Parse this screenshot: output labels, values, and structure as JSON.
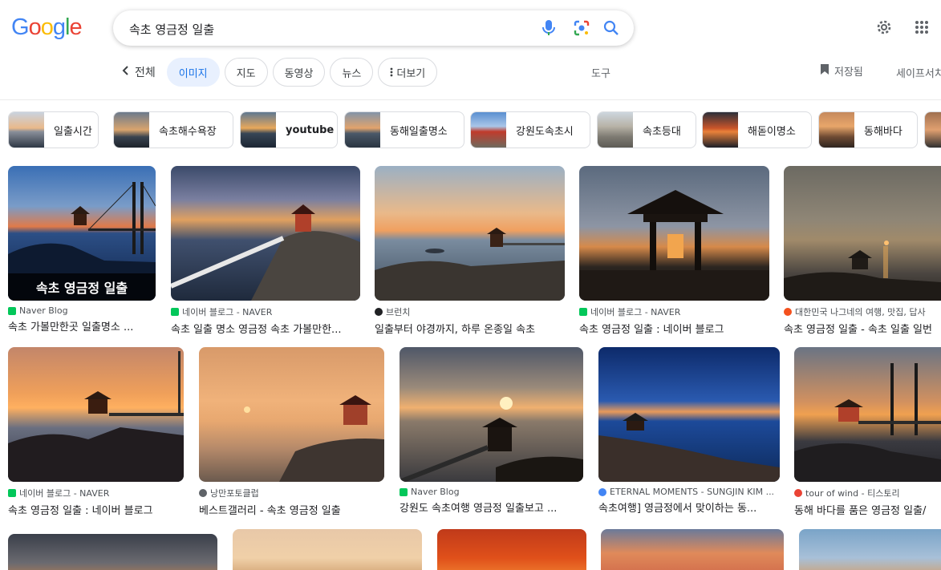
{
  "logo": "Google",
  "search": {
    "query": "속초 영금정 일출"
  },
  "tabs": {
    "back_label": "전체",
    "items": [
      "이미지",
      "지도",
      "동영상",
      "뉴스",
      "더보기"
    ],
    "active_index": 0,
    "tools": "도구",
    "saved": "저장됨",
    "safesearch": "세이프서치"
  },
  "suggestions": [
    "일출시간",
    "속초해수욕장",
    "youtube",
    "동해일출명소",
    "강원도속초시",
    "속초등대",
    "해돋이명소",
    "동해바다"
  ],
  "results": [
    {
      "source": "Naver Blog",
      "title": "속초 가볼만한곳 일출명소 ...",
      "overlay": "속초 영금정 일출",
      "fav_color": "#03c75a"
    },
    {
      "source": "네이버 블로그 - NAVER",
      "title": "속초 일출 명소 영금정 속초 가볼만한...",
      "fav_color": "#03c75a"
    },
    {
      "source": "브런치",
      "title": "일출부터 야경까지, 하루 온종일 속초",
      "fav_color": "#202124"
    },
    {
      "source": "네이버 블로그 - NAVER",
      "title": "속초 영금정 일출 : 네이버 블로그",
      "fav_color": "#03c75a"
    },
    {
      "source": "대한민국 나그네의 여행, 맛집, 답사",
      "title": "속초 영금정 일출 - 속초 일출 일번",
      "fav_color": "#f4511e"
    },
    {
      "source": "네이버 블로그 - NAVER",
      "title": "속초 영금정 일출 : 네이버 블로그",
      "fav_color": "#03c75a"
    },
    {
      "source": "낭만포토클럽",
      "title": "베스트갤러리 - 속초 영금정 일출",
      "fav_color": "#5f6368"
    },
    {
      "source": "Naver Blog",
      "title": "강원도 속초여행 영금정 일출보고 ...",
      "fav_color": "#03c75a"
    },
    {
      "source": "ETERNAL MOMENTS - SUNGJIN KIM ...",
      "title": "속초여행] 영금정에서 맞이하는 동...",
      "fav_color": "#4285f4"
    },
    {
      "source": "tour of wind - 티스토리",
      "title": "동해 바다를 품은 영금정 일출/",
      "fav_color": "#ea4335"
    }
  ],
  "colors": {
    "accent": "#1a73e8",
    "active_chip_bg": "#e8f0fe"
  },
  "icons": [
    "mic-icon",
    "lens-icon",
    "search-icon",
    "settings-icon",
    "apps-icon",
    "chevron-left-icon",
    "more-vert-icon",
    "bookmark-icon"
  ]
}
